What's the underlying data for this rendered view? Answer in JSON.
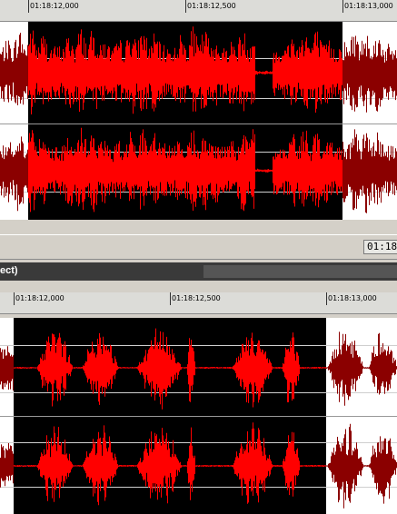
{
  "top_panel": {
    "ruler_labels": [
      "01:18:12,000",
      "01:18:12,500",
      "01:18:13,000"
    ],
    "selection": "black",
    "waveform_color_selected": "#ff0000",
    "waveform_color_unselected": "#8b0000"
  },
  "status": {
    "time_value": "01:18"
  },
  "bottom_panel": {
    "title_text": "ect)",
    "ruler_labels": [
      "01:18:12,000",
      "01:18:12,500",
      "01:18:13,000"
    ]
  }
}
